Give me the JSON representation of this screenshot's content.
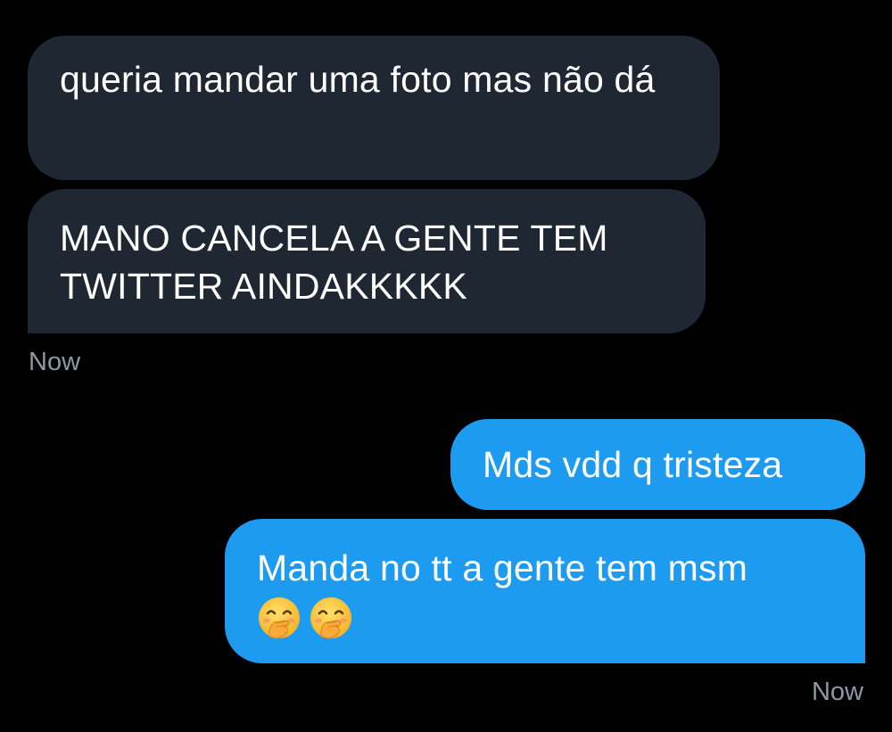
{
  "conversation": {
    "received": [
      {
        "text": "queria mandar uma foto mas não dá"
      },
      {
        "text": "MANO CANCELA A GENTE TEM TWITTER AINDAKKKKK"
      }
    ],
    "received_timestamp": "Now",
    "sent": [
      {
        "text": "Mds vdd q tristeza"
      },
      {
        "text": "Manda no tt a gente tem msm",
        "emojis": [
          "face-with-hand-over-mouth",
          "face-with-hand-over-mouth"
        ]
      }
    ],
    "sent_timestamp": "Now"
  },
  "colors": {
    "background": "#000000",
    "received_bubble": "#1f2732",
    "sent_bubble": "#1d9bf0",
    "timestamp": "#8b98a5"
  }
}
